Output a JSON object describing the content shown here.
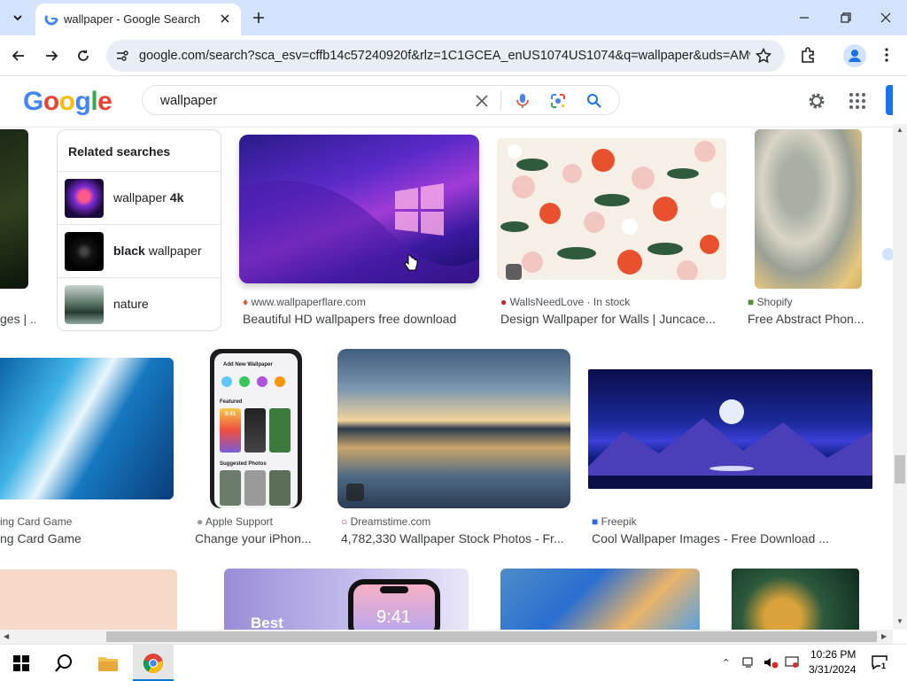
{
  "browser": {
    "tab_title": "wallpaper - Google Search",
    "url": "google.com/search?sca_esv=cffb14c57240920f&rlz=1C1GCEA_enUS1074US1074&q=wallpaper&uds=AMwkr..."
  },
  "google": {
    "logo": "Google",
    "query": "wallpaper"
  },
  "related": {
    "heading": "Related searches",
    "items": [
      {
        "prefix": "wallpaper ",
        "bold": "4k",
        "suffix": ""
      },
      {
        "prefix": "",
        "bold": "black",
        "suffix": " wallpaper"
      },
      {
        "prefix": "nature",
        "bold": "",
        "suffix": ""
      }
    ]
  },
  "results": {
    "row1_left_partial_title": "ges | ...",
    "r1": [
      {
        "source": "www.wallpaperflare.com",
        "title": "Beautiful HD wallpapers free download"
      },
      {
        "source": "WallsNeedLove · In stock",
        "title": "Design Wallpaper for Walls | Juncace..."
      },
      {
        "source": "Shopify",
        "title": "Free Abstract Phon..."
      }
    ],
    "r2": [
      {
        "source": "ing Card Game",
        "title": "ng Card Game"
      },
      {
        "source": "Apple Support",
        "title": "Change your iPhon..."
      },
      {
        "source": "Dreamstime.com",
        "title": "4,782,330 Wallpaper Stock Photos - Fr..."
      },
      {
        "source": "Freepik",
        "title": "Cool Wallpaper Images - Free Download ..."
      }
    ],
    "phone": {
      "header": "Add New Wallpaper",
      "featured": "Featured",
      "suggested": "Suggested Photos",
      "time": "9:41"
    },
    "r3": {
      "best": "Best",
      "time": "9:41"
    }
  },
  "taskbar": {
    "time": "10:26 PM",
    "date": "3/31/2024"
  },
  "colors": {
    "accent": "#1a73e8",
    "tabstrip": "#d3e3fd",
    "omnibox": "#e9eef6"
  }
}
